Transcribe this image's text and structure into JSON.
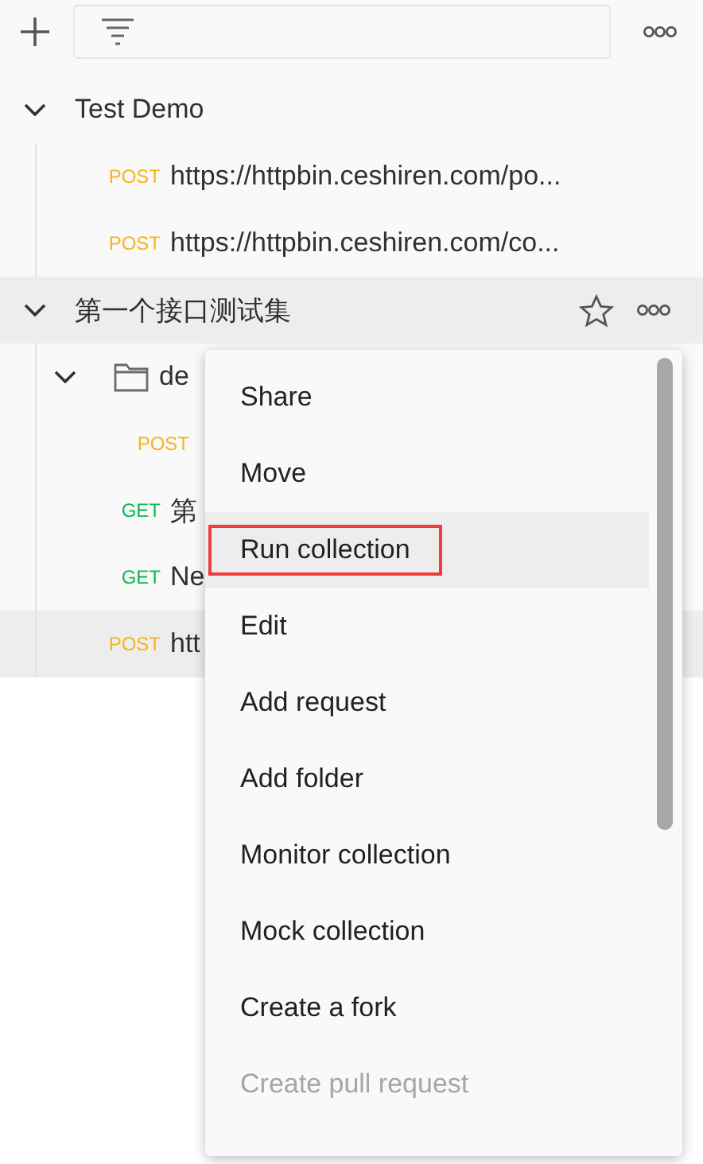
{
  "collections": [
    {
      "name": "Test Demo",
      "expanded": true,
      "selected": false,
      "children": [
        {
          "kind": "request",
          "method": "POST",
          "name": "https://httpbin.ceshiren.com/po...",
          "selected": false
        },
        {
          "kind": "request",
          "method": "POST",
          "name": "https://httpbin.ceshiren.com/co...",
          "selected": false
        }
      ]
    },
    {
      "name": "第一个接口测试集",
      "expanded": true,
      "selected": true,
      "children": [
        {
          "kind": "folder",
          "name": "de",
          "expanded": true,
          "selected": false,
          "children": [
            {
              "kind": "request",
              "method": "POST",
              "selected": false
            }
          ]
        },
        {
          "kind": "request",
          "method": "GET",
          "name": "第",
          "selected": false
        },
        {
          "kind": "request",
          "method": "GET",
          "name": "Ne",
          "selected": false
        },
        {
          "kind": "request",
          "method": "POST",
          "name": "htt",
          "selected": true
        }
      ]
    }
  ],
  "context_menu": [
    {
      "label": "Share",
      "selected": false,
      "disabled": false,
      "outlined": false
    },
    {
      "label": "Move",
      "selected": false,
      "disabled": false,
      "outlined": false
    },
    {
      "label": "Run collection",
      "selected": true,
      "disabled": false,
      "outlined": true
    },
    {
      "label": "Edit",
      "selected": false,
      "disabled": false,
      "outlined": false
    },
    {
      "label": "Add request",
      "selected": false,
      "disabled": false,
      "outlined": false
    },
    {
      "label": "Add folder",
      "selected": false,
      "disabled": false,
      "outlined": false
    },
    {
      "label": "Monitor collection",
      "selected": false,
      "disabled": false,
      "outlined": false
    },
    {
      "label": "Mock collection",
      "selected": false,
      "disabled": false,
      "outlined": false
    },
    {
      "label": "Create a fork",
      "selected": false,
      "disabled": false,
      "outlined": false
    },
    {
      "label": "Create pull request",
      "selected": false,
      "disabled": true,
      "outlined": false
    }
  ]
}
